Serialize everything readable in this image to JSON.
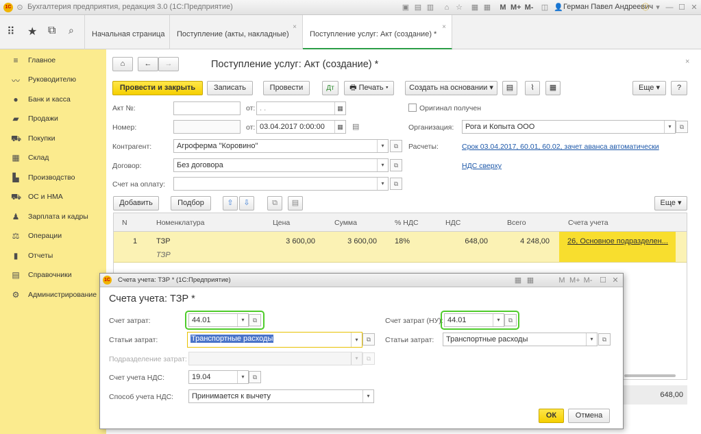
{
  "window": {
    "title": "Бухгалтерия предприятия, редакция 3.0  (1С:Предприятие)",
    "user": "Герман Павел Андреевич",
    "m_labels": [
      "M",
      "M+",
      "M-"
    ]
  },
  "tabs": [
    {
      "label": "Начальная страница"
    },
    {
      "label": "Поступление (акты, накладные)"
    },
    {
      "label": "Поступление услуг: Акт (создание) *"
    }
  ],
  "sidebar": {
    "items": [
      {
        "label": "Главное",
        "icon": "menu-icon"
      },
      {
        "label": "Руководителю",
        "icon": "chart-icon"
      },
      {
        "label": "Банк и касса",
        "icon": "coin-icon"
      },
      {
        "label": "Продажи",
        "icon": "bag-icon"
      },
      {
        "label": "Покупки",
        "icon": "cart-icon"
      },
      {
        "label": "Склад",
        "icon": "warehouse-icon"
      },
      {
        "label": "Производство",
        "icon": "factory-icon"
      },
      {
        "label": "ОС и НМА",
        "icon": "truck-icon"
      },
      {
        "label": "Зарплата и кадры",
        "icon": "person-icon"
      },
      {
        "label": "Операции",
        "icon": "operations-icon"
      },
      {
        "label": "Отчеты",
        "icon": "report-icon"
      },
      {
        "label": "Справочники",
        "icon": "book-icon"
      },
      {
        "label": "Администрирование",
        "icon": "gear-icon"
      }
    ]
  },
  "doc": {
    "title": "Поступление услуг: Акт (создание) *",
    "buttons": {
      "post_close": "Провести и закрыть",
      "save": "Записать",
      "post": "Провести",
      "print": "Печать",
      "create_based": "Создать на основании",
      "more": "Еще",
      "help": "?"
    },
    "fields": {
      "act_no_label": "Акт №:",
      "from_label": "от:",
      "act_date": ".  .",
      "number_label": "Номер:",
      "number_date": "03.04.2017  0:00:00",
      "counterparty_label": "Контрагент:",
      "counterparty": "Агроферма \"Коровино\"",
      "contract_label": "Договор:",
      "contract": "Без договора",
      "invoice_label": "Счет на оплату:",
      "invoice": "",
      "original_received": "Оригинал получен",
      "org_label": "Организация:",
      "org": "Рога и Копыта ООО",
      "settlements_label": "Расчеты:",
      "settlements_link": "Срок 03.04.2017, 60.01, 60.02, зачет аванса автоматически",
      "vat_link": "НДС сверху"
    },
    "table_buttons": {
      "add": "Добавить",
      "pick": "Подбор",
      "more": "Еще"
    },
    "table": {
      "columns": [
        "N",
        "Номенклатура",
        "Цена",
        "Сумма",
        "% НДС",
        "НДС",
        "Всего",
        "Счета учета"
      ],
      "rows": [
        {
          "n": "1",
          "item": "ТЗР",
          "item2": "ТЗР",
          "price": "3 600,00",
          "sum": "3 600,00",
          "vat_rate": "18%",
          "vat": "648,00",
          "total": "4 248,00",
          "account": "26, Основное подразделен..."
        }
      ]
    },
    "total_vat": "648,00"
  },
  "dialog": {
    "window_title": "Счета учета: ТЗР * (1С:Предприятие)",
    "heading": "Счета учета: ТЗР *",
    "cost_account_label": "Счет затрат:",
    "cost_account": "44.01",
    "cost_item_label": "Статьи затрат:",
    "cost_item": "Транспортные расходы",
    "division_label": "Подразделение затрат:",
    "division": "",
    "vat_account_label": "Счет учета НДС:",
    "vat_account": "19.04",
    "vat_method_label": "Способ учета НДС:",
    "vat_method": "Принимается к вычету",
    "cost_account_nu_label": "Счет затрат (НУ):",
    "cost_account_nu": "44.01",
    "cost_item_nu_label": "Статьи затрат:",
    "cost_item_nu": "Транспортные расходы",
    "ok": "ОК",
    "cancel": "Отмена"
  }
}
